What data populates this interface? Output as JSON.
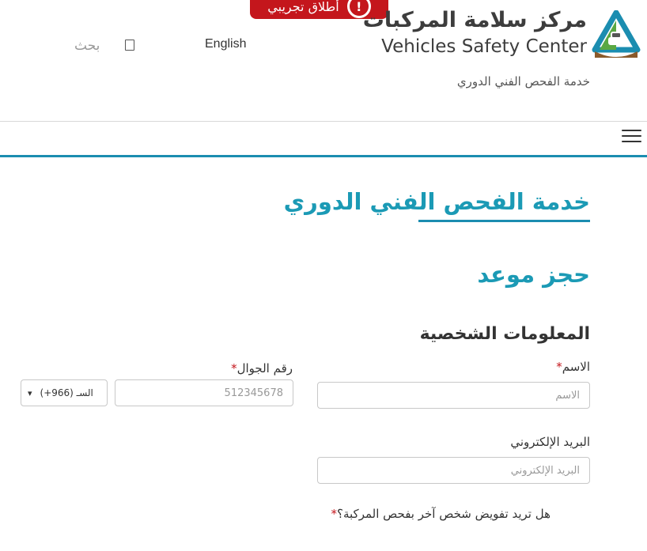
{
  "header": {
    "beta_badge": "أطلاق تجريبي",
    "beta_icon": "!",
    "brand_ar": "مركز سلامة المركبات",
    "brand_en": "Vehicles Safety Center",
    "service_subtitle": "خدمة الفحص الفني الدوري",
    "language_link": "English",
    "search_label": "بحث"
  },
  "colors": {
    "accent": "#1b9ab5",
    "badge": "#c4161c",
    "emblem_blue": "#1b8db0",
    "emblem_green": "#5aa843",
    "emblem_brown": "#8a5a2b"
  },
  "main": {
    "page_title": "خدمة الفحص الفني الدوري",
    "section_title": "حجز موعد",
    "personal_info_title": "المعلومات الشخصية",
    "fields": {
      "name_label": "الاسم",
      "name_placeholder": "الاسم",
      "phone_label": "رقم الجوال",
      "phone_placeholder": "512345678",
      "country_code": "(+966) السـ",
      "email_label": "البريد الإلكتروني",
      "email_placeholder": "البريد الإلكتروني",
      "required_mark": "*"
    },
    "delegate_question": "هل تريد تفويض شخص آخر بفحص المركبة؟"
  }
}
